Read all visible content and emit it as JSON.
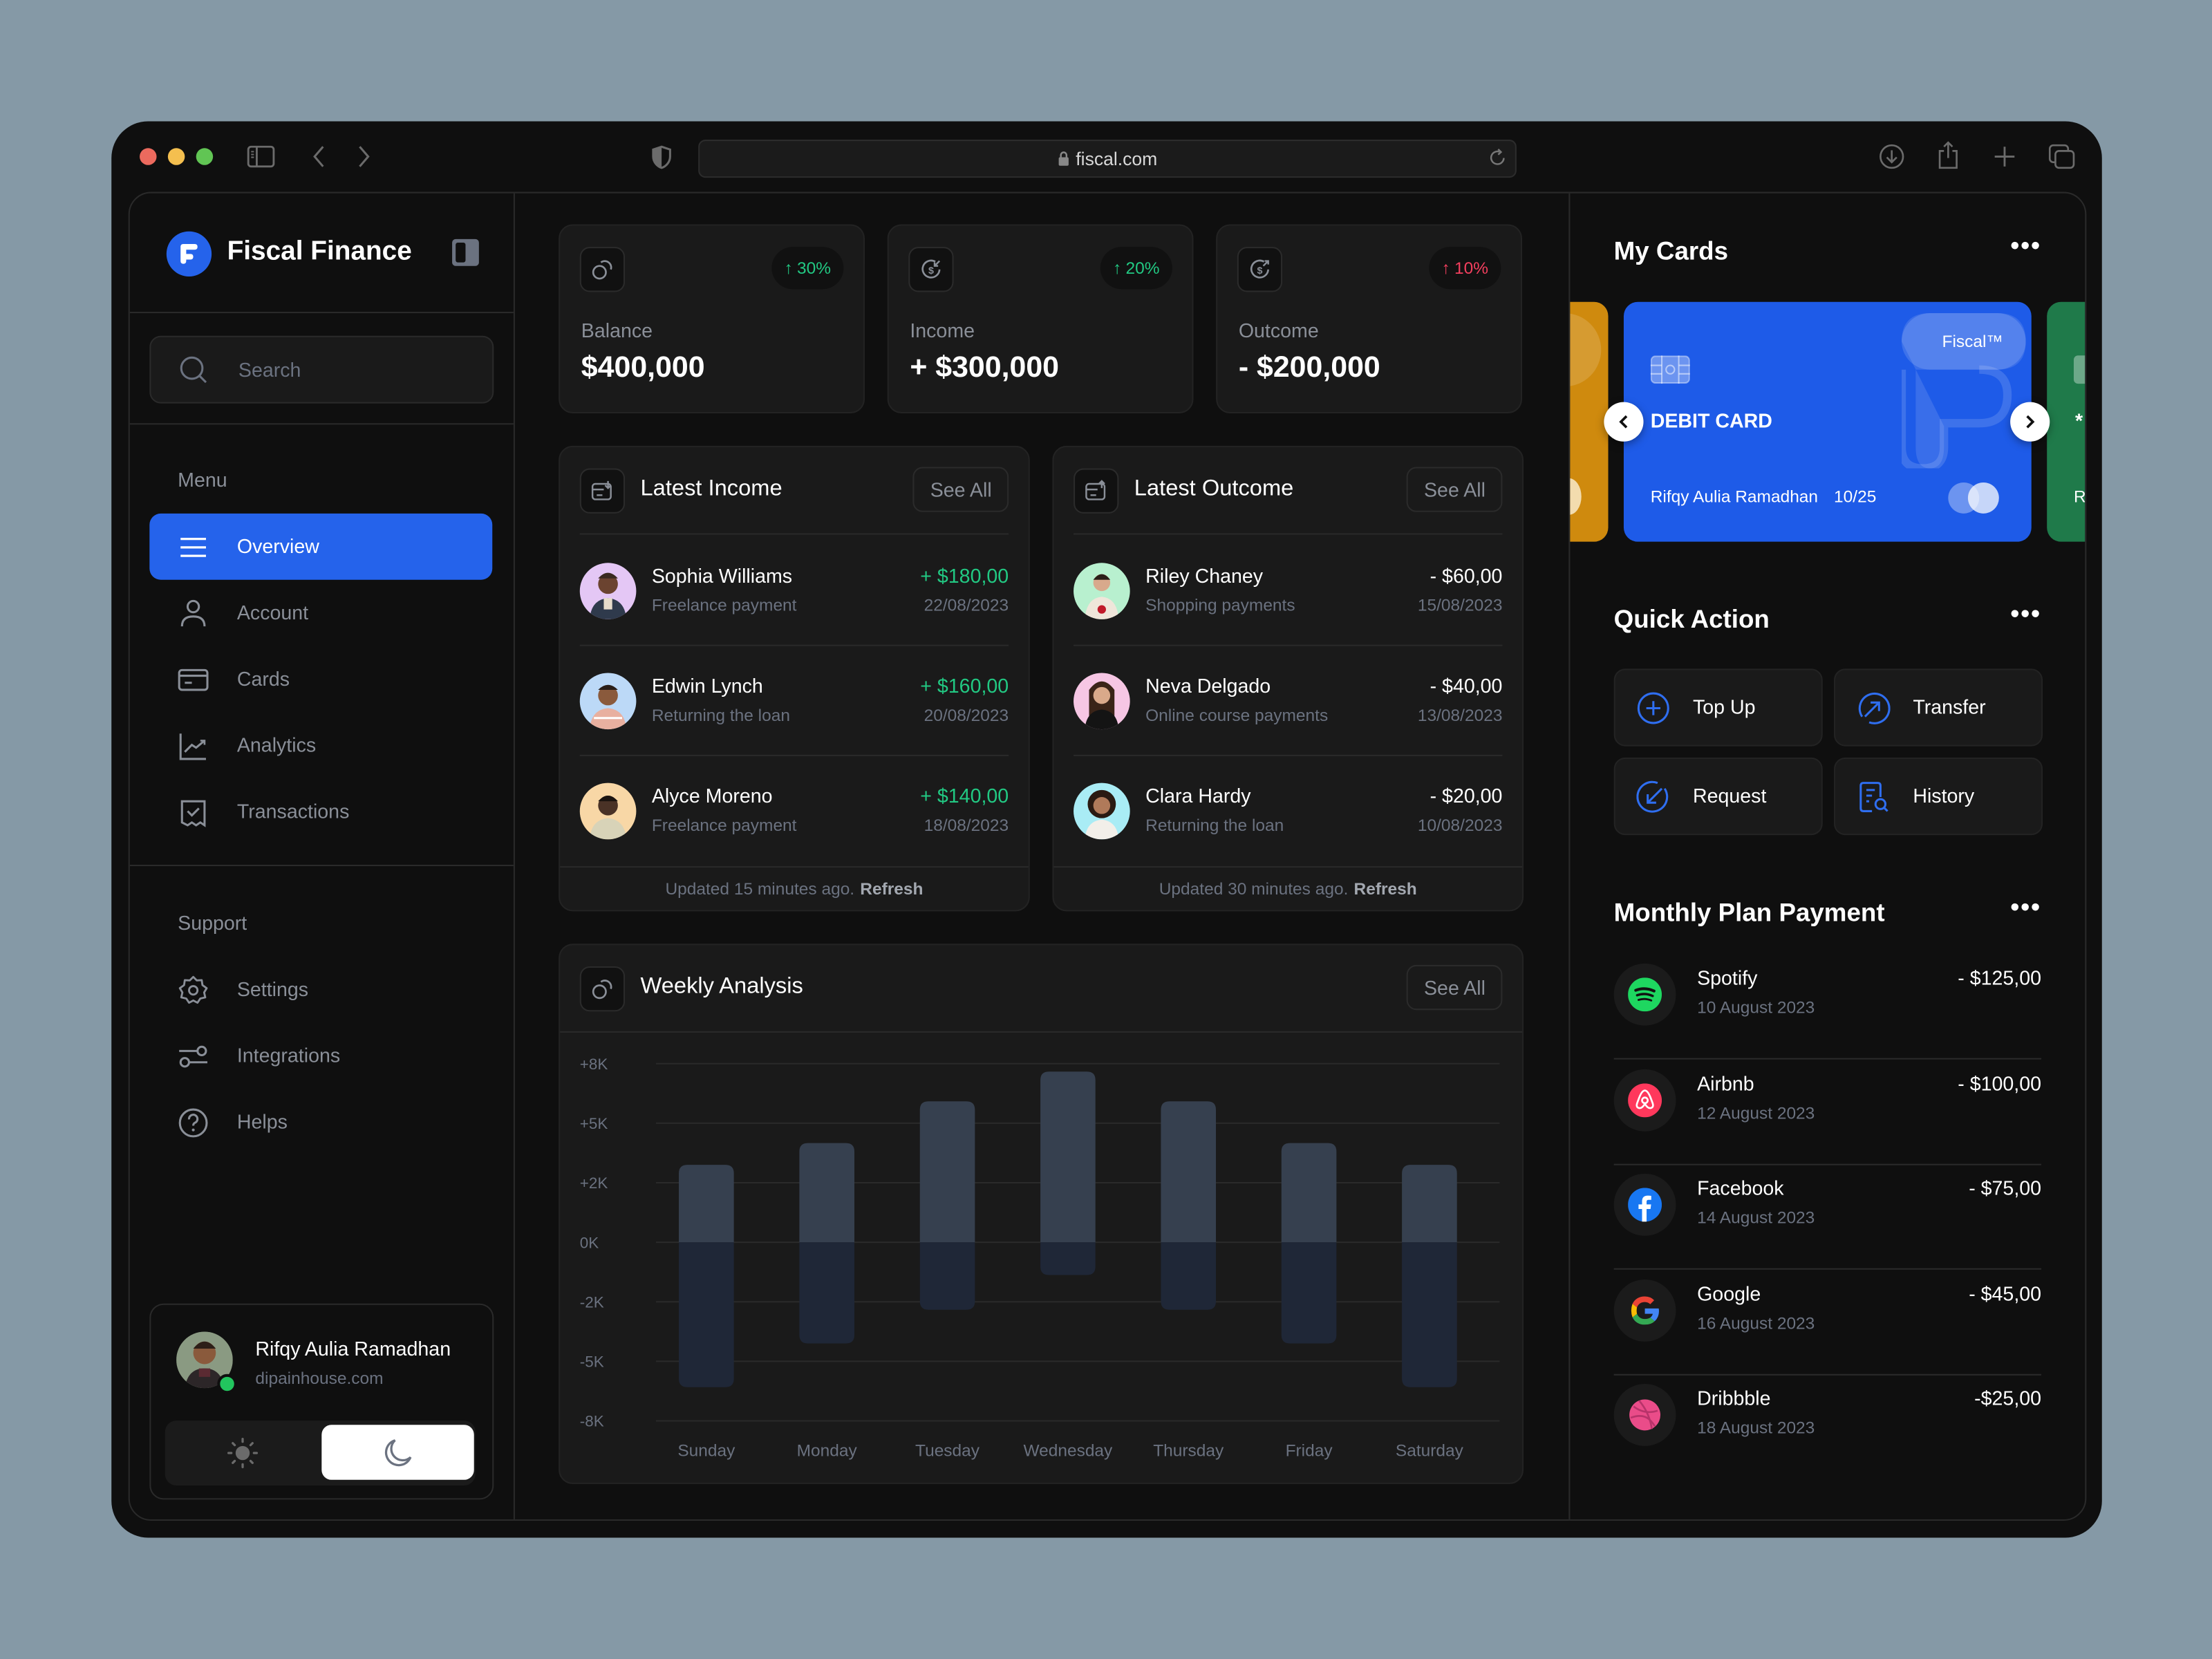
{
  "browser": {
    "url": "fiscal.com",
    "traffic_lights": [
      "#ec6a5e",
      "#f4bf4f",
      "#61c554"
    ],
    "icons": [
      "sidebar-toggle-icon",
      "back-icon",
      "forward-icon",
      "shield-icon",
      "lock-icon",
      "reload-icon",
      "download-icon",
      "share-icon",
      "new-tab-icon",
      "tabs-overview-icon"
    ]
  },
  "theme": {
    "accent": "#2563eb",
    "positive": "#22c983",
    "negative": "#f43f5e",
    "background": "#0f0f0f",
    "panel": "#1a1a1a"
  },
  "sidebar": {
    "brand": "Fiscal Finance",
    "search_placeholder": "Search",
    "menu_label": "Menu",
    "menu": [
      {
        "label": "Overview",
        "icon": "menu-lines-icon",
        "active": true
      },
      {
        "label": "Account",
        "icon": "user-icon",
        "active": false
      },
      {
        "label": "Cards",
        "icon": "credit-card-icon",
        "active": false
      },
      {
        "label": "Analytics",
        "icon": "chart-line-icon",
        "active": false
      },
      {
        "label": "Transactions",
        "icon": "receipt-icon",
        "active": false
      }
    ],
    "support_label": "Support",
    "support": [
      {
        "label": "Settings",
        "icon": "gear-icon"
      },
      {
        "label": "Integrations",
        "icon": "toggles-icon"
      },
      {
        "label": "Helps",
        "icon": "help-circle-icon"
      }
    ],
    "user": {
      "name": "Rifqy Aulia Ramadhan",
      "site": "dipainhouse.com",
      "status": "online"
    },
    "theme_toggle": {
      "options": [
        "light",
        "dark"
      ],
      "selected": "dark"
    }
  },
  "stats": [
    {
      "label": "Balance",
      "value": "$400,000",
      "change": "30%",
      "direction": "up",
      "tone": "positive",
      "icon": "coins-icon"
    },
    {
      "label": "Income",
      "value": "+ $300,000",
      "change": "20%",
      "direction": "up",
      "tone": "positive",
      "icon": "dollar-in-icon"
    },
    {
      "label": "Outcome",
      "value": "- $200,000",
      "change": "10%",
      "direction": "up",
      "tone": "negative",
      "icon": "dollar-out-icon"
    }
  ],
  "latest_income": {
    "title": "Latest Income",
    "see_all": "See All",
    "items": [
      {
        "name": "Sophia Williams",
        "desc": "Freelance payment",
        "amount": "+ $180,00",
        "date": "22/08/2023",
        "avatar_bg": "#e4c7f5"
      },
      {
        "name": "Edwin Lynch",
        "desc": "Returning the loan",
        "amount": "+ $160,00",
        "date": "20/08/2023",
        "avatar_bg": "#bcd9f7"
      },
      {
        "name": "Alyce Moreno",
        "desc": "Freelance payment",
        "amount": "+ $140,00",
        "date": "18/08/2023",
        "avatar_bg": "#f8d7a6"
      }
    ],
    "footer_text": "Updated 15 minutes ago.",
    "footer_action": "Refresh"
  },
  "latest_outcome": {
    "title": "Latest Outcome",
    "see_all": "See All",
    "items": [
      {
        "name": "Riley Chaney",
        "desc": "Shopping payments",
        "amount": "- $60,00",
        "date": "15/08/2023",
        "avatar_bg": "#b8f0cf"
      },
      {
        "name": "Neva Delgado",
        "desc": "Online course payments",
        "amount": "- $40,00",
        "date": "13/08/2023",
        "avatar_bg": "#f6c6e4"
      },
      {
        "name": "Clara Hardy",
        "desc": "Returning the loan",
        "amount": "- $20,00",
        "date": "10/08/2023",
        "avatar_bg": "#a9ecf5"
      }
    ],
    "footer_text": "Updated 30 minutes ago.",
    "footer_action": "Refresh"
  },
  "weekly": {
    "title": "Weekly Analysis",
    "see_all": "See All"
  },
  "chart_data": {
    "type": "bar",
    "title": "Weekly Analysis",
    "categories": [
      "Sunday",
      "Monday",
      "Tuesday",
      "Wednesday",
      "Thursday",
      "Friday",
      "Saturday"
    ],
    "series": [
      {
        "name": "Income",
        "values": [
          2.9,
          4.0,
          6.1,
          7.6,
          6.1,
          4.0,
          2.9
        ],
        "color": "#36404f"
      },
      {
        "name": "Outcome",
        "values": [
          -6.3,
          -4.1,
          -2.4,
          -1.1,
          -2.4,
          -4.1,
          -6.3
        ],
        "color": "#1f2737"
      }
    ],
    "yticks": [
      "+8K",
      "+5K",
      "+2K",
      "0K",
      "-2K",
      "-5K",
      "-8K"
    ],
    "ytick_values": [
      8,
      5,
      2,
      0,
      -2,
      -5,
      -8
    ],
    "ylim": [
      -8,
      8
    ],
    "unit": "K",
    "grid": true,
    "xlabel": "",
    "ylabel": ""
  },
  "my_cards": {
    "title": "My Cards",
    "cards": [
      {
        "type": "DEBIT CARD",
        "brand": "Fiscal™",
        "holder": "Rifqy Aulia Ramadhan",
        "expiry": "10/25",
        "color": "#1e5be8"
      }
    ],
    "side_cards": [
      {
        "color": "#cf8a0e",
        "position": "previous"
      },
      {
        "color": "#1f7a4a",
        "position": "next",
        "partial_text": "*",
        "partial_holder": "R"
      }
    ]
  },
  "quick_action": {
    "title": "Quick Action",
    "items": [
      {
        "label": "Top Up",
        "icon": "plus-circle-icon"
      },
      {
        "label": "Transfer",
        "icon": "arrow-up-right-circle-icon"
      },
      {
        "label": "Request",
        "icon": "arrow-down-left-circle-icon"
      },
      {
        "label": "History",
        "icon": "document-search-icon"
      }
    ]
  },
  "monthly_plan": {
    "title": "Monthly Plan Payment",
    "items": [
      {
        "name": "Spotify",
        "date": "10 August 2023",
        "amount": "- $125,00",
        "icon": "spotify-icon"
      },
      {
        "name": "Airbnb",
        "date": "12 August 2023",
        "amount": "- $100,00",
        "icon": "airbnb-icon"
      },
      {
        "name": "Facebook",
        "date": "14 August 2023",
        "amount": "- $75,00",
        "icon": "facebook-icon"
      },
      {
        "name": "Google",
        "date": "16 August 2023",
        "amount": "- $45,00",
        "icon": "google-icon"
      },
      {
        "name": "Dribbble",
        "date": "18 August 2023",
        "amount": "-$25,00",
        "icon": "dribbble-icon"
      }
    ]
  }
}
